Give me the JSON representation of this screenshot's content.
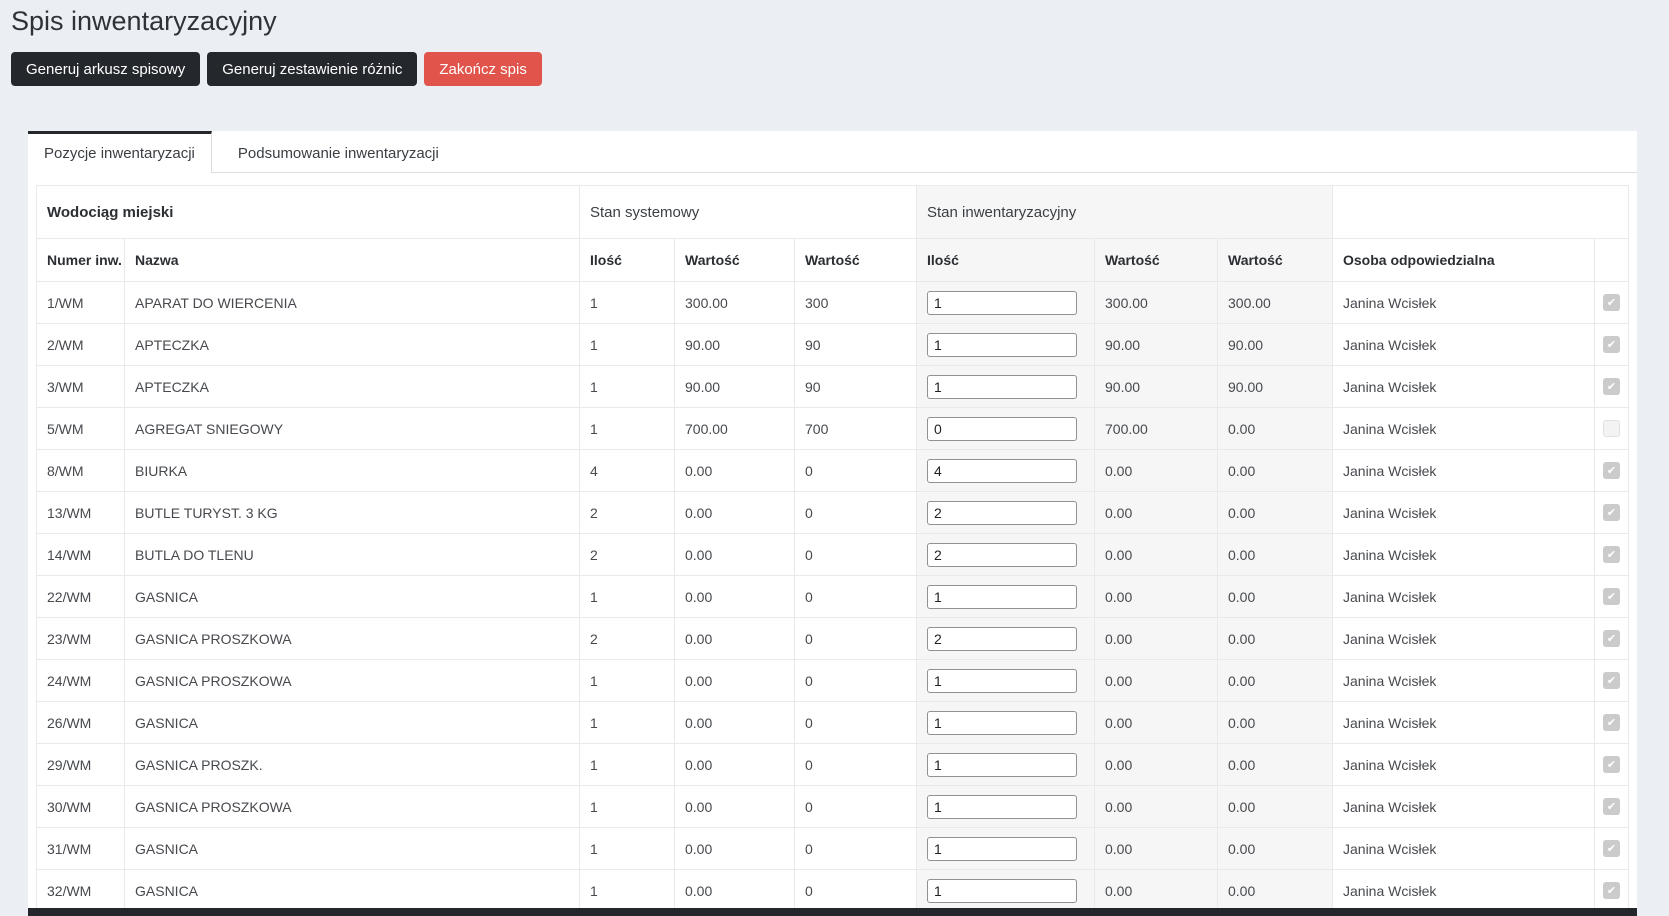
{
  "page": {
    "title": "Spis inwentaryzacyjny"
  },
  "toolbar": {
    "buttons": [
      {
        "label": "Generuj arkusz spisowy",
        "style": "dark"
      },
      {
        "label": "Generuj zestawienie różnic",
        "style": "dark"
      },
      {
        "label": "Zakończ spis",
        "style": "danger"
      }
    ]
  },
  "tabs": [
    {
      "label": "Pozycje inwentaryzacji",
      "active": true
    },
    {
      "label": "Podsumowanie inwentaryzacji",
      "active": false
    }
  ],
  "table": {
    "group_headers": {
      "location": "Wodociąg miejski",
      "system": "Stan systemowy",
      "inventory": "Stan inwentaryzacyjny"
    },
    "columns": [
      "Numer inw.",
      "Nazwa",
      "Ilość",
      "Wartość",
      "Wartość",
      "Ilość",
      "Wartość",
      "Wartość",
      "Osoba odpowiedzialna"
    ],
    "rows": [
      {
        "numer": "1/WM",
        "nazwa": "APARAT DO WIERCENIA",
        "sys_ilosc": "1",
        "sys_wartosc1": "300.00",
        "sys_wartosc2": "300",
        "inw_ilosc": "1",
        "inw_wartosc1": "300.00",
        "inw_wartosc2": "300.00",
        "osoba": "Janina Wcisłek",
        "checked": true
      },
      {
        "numer": "2/WM",
        "nazwa": "APTECZKA",
        "sys_ilosc": "1",
        "sys_wartosc1": "90.00",
        "sys_wartosc2": "90",
        "inw_ilosc": "1",
        "inw_wartosc1": "90.00",
        "inw_wartosc2": "90.00",
        "osoba": "Janina Wcisłek",
        "checked": true
      },
      {
        "numer": "3/WM",
        "nazwa": "APTECZKA",
        "sys_ilosc": "1",
        "sys_wartosc1": "90.00",
        "sys_wartosc2": "90",
        "inw_ilosc": "1",
        "inw_wartosc1": "90.00",
        "inw_wartosc2": "90.00",
        "osoba": "Janina Wcisłek",
        "checked": true
      },
      {
        "numer": "5/WM",
        "nazwa": "AGREGAT SNIEGOWY",
        "sys_ilosc": "1",
        "sys_wartosc1": "700.00",
        "sys_wartosc2": "700",
        "inw_ilosc": "0",
        "inw_wartosc1": "700.00",
        "inw_wartosc2": "0.00",
        "osoba": "Janina Wcisłek",
        "checked": false
      },
      {
        "numer": "8/WM",
        "nazwa": "BIURKA",
        "sys_ilosc": "4",
        "sys_wartosc1": "0.00",
        "sys_wartosc2": "0",
        "inw_ilosc": "4",
        "inw_wartosc1": "0.00",
        "inw_wartosc2": "0.00",
        "osoba": "Janina Wcisłek",
        "checked": true
      },
      {
        "numer": "13/WM",
        "nazwa": "BUTLE TURYST. 3 KG",
        "sys_ilosc": "2",
        "sys_wartosc1": "0.00",
        "sys_wartosc2": "0",
        "inw_ilosc": "2",
        "inw_wartosc1": "0.00",
        "inw_wartosc2": "0.00",
        "osoba": "Janina Wcisłek",
        "checked": true
      },
      {
        "numer": "14/WM",
        "nazwa": "BUTLA DO TLENU",
        "sys_ilosc": "2",
        "sys_wartosc1": "0.00",
        "sys_wartosc2": "0",
        "inw_ilosc": "2",
        "inw_wartosc1": "0.00",
        "inw_wartosc2": "0.00",
        "osoba": "Janina Wcisłek",
        "checked": true
      },
      {
        "numer": "22/WM",
        "nazwa": "GASNICA",
        "sys_ilosc": "1",
        "sys_wartosc1": "0.00",
        "sys_wartosc2": "0",
        "inw_ilosc": "1",
        "inw_wartosc1": "0.00",
        "inw_wartosc2": "0.00",
        "osoba": "Janina Wcisłek",
        "checked": true
      },
      {
        "numer": "23/WM",
        "nazwa": "GASNICA PROSZKOWA",
        "sys_ilosc": "2",
        "sys_wartosc1": "0.00",
        "sys_wartosc2": "0",
        "inw_ilosc": "2",
        "inw_wartosc1": "0.00",
        "inw_wartosc2": "0.00",
        "osoba": "Janina Wcisłek",
        "checked": true
      },
      {
        "numer": "24/WM",
        "nazwa": "GASNICA PROSZKOWA",
        "sys_ilosc": "1",
        "sys_wartosc1": "0.00",
        "sys_wartosc2": "0",
        "inw_ilosc": "1",
        "inw_wartosc1": "0.00",
        "inw_wartosc2": "0.00",
        "osoba": "Janina Wcisłek",
        "checked": true
      },
      {
        "numer": "26/WM",
        "nazwa": "GASNICA",
        "sys_ilosc": "1",
        "sys_wartosc1": "0.00",
        "sys_wartosc2": "0",
        "inw_ilosc": "1",
        "inw_wartosc1": "0.00",
        "inw_wartosc2": "0.00",
        "osoba": "Janina Wcisłek",
        "checked": true
      },
      {
        "numer": "29/WM",
        "nazwa": "GASNICA PROSZK.",
        "sys_ilosc": "1",
        "sys_wartosc1": "0.00",
        "sys_wartosc2": "0",
        "inw_ilosc": "1",
        "inw_wartosc1": "0.00",
        "inw_wartosc2": "0.00",
        "osoba": "Janina Wcisłek",
        "checked": true
      },
      {
        "numer": "30/WM",
        "nazwa": "GASNICA PROSZKOWA",
        "sys_ilosc": "1",
        "sys_wartosc1": "0.00",
        "sys_wartosc2": "0",
        "inw_ilosc": "1",
        "inw_wartosc1": "0.00",
        "inw_wartosc2": "0.00",
        "osoba": "Janina Wcisłek",
        "checked": true
      },
      {
        "numer": "31/WM",
        "nazwa": "GASNICA",
        "sys_ilosc": "1",
        "sys_wartosc1": "0.00",
        "sys_wartosc2": "0",
        "inw_ilosc": "1",
        "inw_wartosc1": "0.00",
        "inw_wartosc2": "0.00",
        "osoba": "Janina Wcisłek",
        "checked": true
      },
      {
        "numer": "32/WM",
        "nazwa": "GASNICA",
        "sys_ilosc": "1",
        "sys_wartosc1": "0.00",
        "sys_wartosc2": "0",
        "inw_ilosc": "1",
        "inw_wartosc1": "0.00",
        "inw_wartosc2": "0.00",
        "osoba": "Janina Wcisłek",
        "checked": true
      }
    ]
  },
  "colors": {
    "page_background": "#ebeef2",
    "button_dark": "#24282c",
    "button_danger": "#e0544b",
    "tab_active_border": "#24282c",
    "inventory_group_background": "#f6f6f6",
    "table_border": "#e9e9e9"
  }
}
